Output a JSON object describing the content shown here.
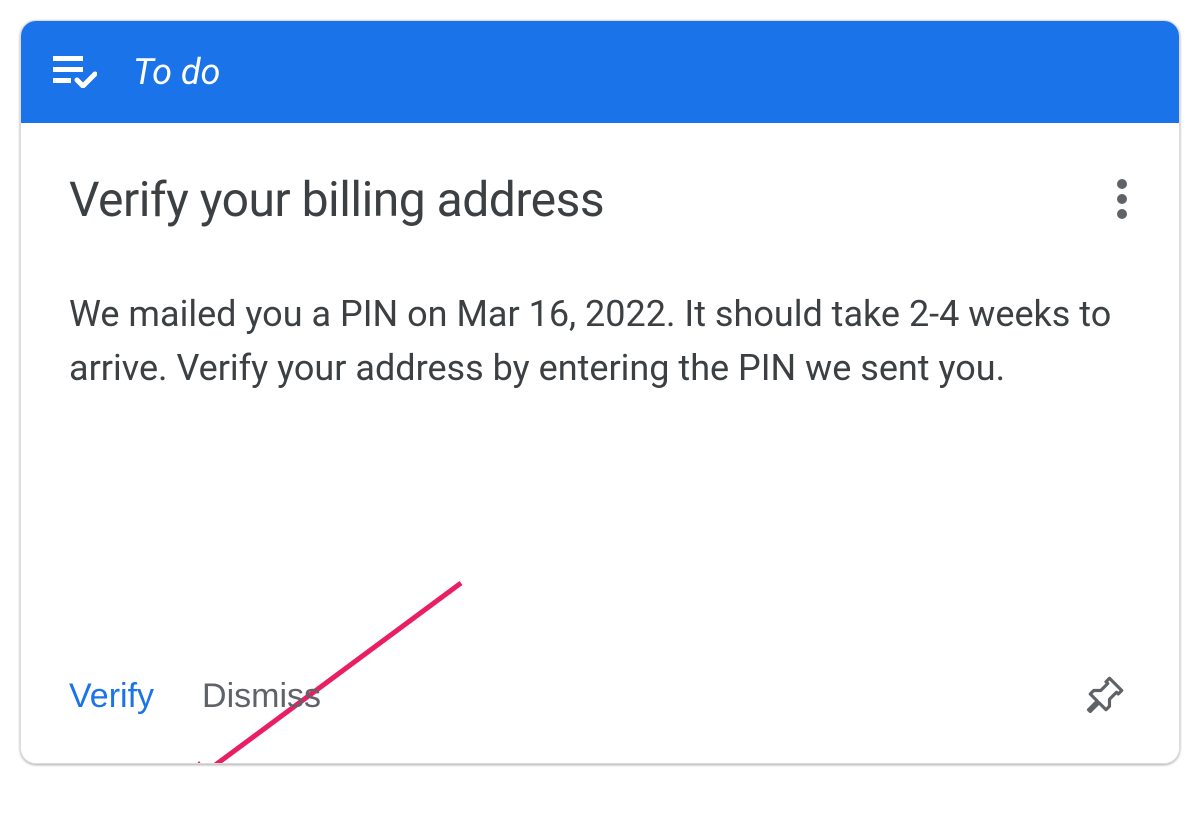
{
  "header": {
    "title": "To do"
  },
  "card": {
    "title": "Verify your billing address",
    "description": "We mailed you a PIN on Mar 16, 2022. It should take 2-4 weeks to arrive. Verify your address by entering the PIN we sent you."
  },
  "actions": {
    "verify_label": "Verify",
    "dismiss_label": "Dismiss"
  }
}
